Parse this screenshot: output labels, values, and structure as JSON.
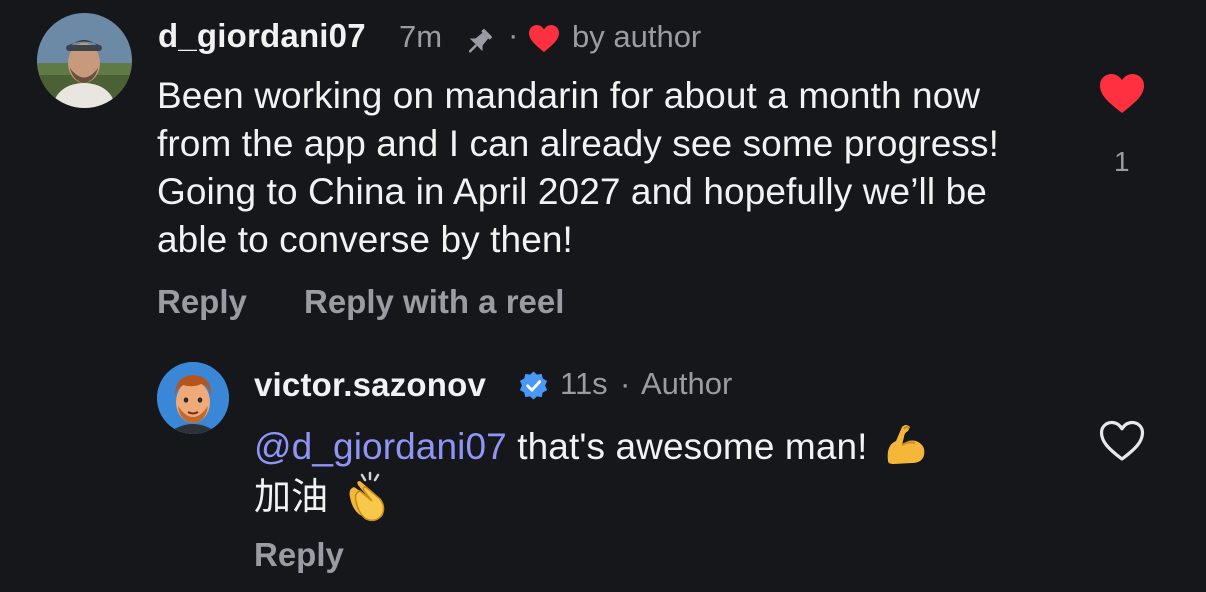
{
  "comment": {
    "username": "d_giordani07",
    "time": "7m",
    "pin_icon": "pin-icon",
    "separator": "·",
    "author_like_label": "by author",
    "text": "Been working on mandarin for about a month now from the app and I can already see some progress! Going to China in April 2027 and hopefully we’ll be able to converse by then!",
    "reply_label": "Reply",
    "reply_reel_label": "Reply with a reel",
    "like_count": "1",
    "like_state": "liked",
    "like_color": "#ff3040"
  },
  "reply": {
    "username": "victor.sazonov",
    "verified_icon": "verified-badge-icon",
    "time": "11s",
    "separator": "·",
    "author_label": "Author",
    "mention": "@d_giordani07",
    "text": " that's awesome man!",
    "text_line2": "加油",
    "emoji_1": "flexed-biceps",
    "emoji_2": "clapping-hands",
    "reply_label": "Reply",
    "like_state": "not-liked"
  },
  "colors": {
    "background": "#16171b",
    "mention": "#8f95f7",
    "verified": "#4a98f5",
    "secondary_text": "#9a9ca3"
  }
}
